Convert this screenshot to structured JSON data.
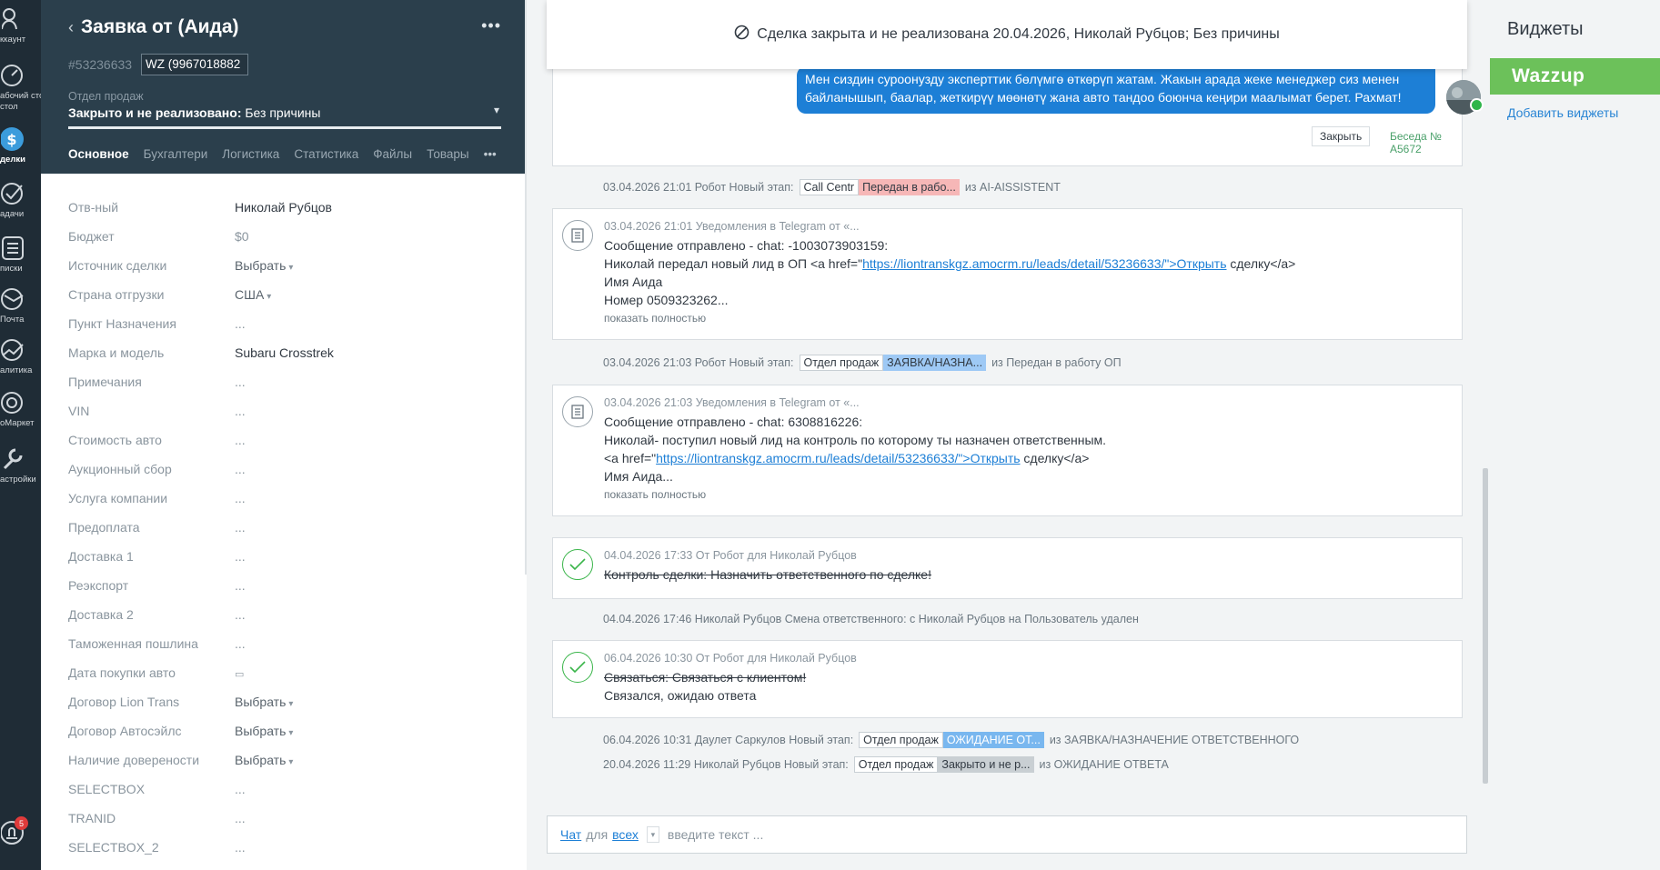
{
  "nav": {
    "items": [
      {
        "label": "ккаунт",
        "icon": "account-icon"
      },
      {
        "label": "абочий стол",
        "label2": "стол",
        "icon": "dashboard-icon"
      },
      {
        "label": "делки",
        "icon": "deals-icon",
        "active": true
      },
      {
        "label": "адачи",
        "icon": "tasks-icon"
      },
      {
        "label": "писки",
        "icon": "lists-icon"
      },
      {
        "label": "Почта",
        "icon": "mail-icon"
      },
      {
        "label": "алитика",
        "icon": "analytics-icon"
      },
      {
        "label": "оМаркет",
        "icon": "market-icon"
      },
      {
        "label": "астройки",
        "icon": "settings-icon"
      }
    ],
    "notifications_count": "5"
  },
  "lead": {
    "title": "Заявка от (Аида)",
    "id": "#53236633",
    "tag": "WZ (9967018882",
    "pipeline_label": "Отдел продаж",
    "status_bold": "Закрыто и не реализовано:",
    "status_reason": " Без причины",
    "tabs": [
      "Основное",
      "Бухгалтери",
      "Логистика",
      "Статистика",
      "Файлы",
      "Товары"
    ],
    "fields": [
      {
        "k": "Отв-ный",
        "v": "Николай Рубцов"
      },
      {
        "k": "Бюджет",
        "v": "$0"
      },
      {
        "k": "Источник сделки",
        "v": "Выбрать"
      },
      {
        "k": "Страна отгрузки",
        "v": "США"
      },
      {
        "k": "Пункт Назначения",
        "v": "..."
      },
      {
        "k": "Марка и модель",
        "v": "Subaru Crosstrek"
      },
      {
        "k": "Примечания",
        "v": "..."
      },
      {
        "k": "VIN",
        "v": "..."
      },
      {
        "k": "Стоимость авто",
        "v": "..."
      },
      {
        "k": "Аукционный сбор",
        "v": "..."
      },
      {
        "k": "Услуга компании",
        "v": "..."
      },
      {
        "k": "Предоплата",
        "v": "..."
      },
      {
        "k": "Доставка 1",
        "v": "..."
      },
      {
        "k": "Реэкспорт",
        "v": "..."
      },
      {
        "k": "Доставка 2",
        "v": "..."
      },
      {
        "k": "Таможенная пошлина",
        "v": "..."
      },
      {
        "k": "Дата покупки авто",
        "v": "▭"
      },
      {
        "k": "Договор Lion Trans",
        "v": "Выбрать"
      },
      {
        "k": "Договор Автосэйлс",
        "v": "Выбрать"
      },
      {
        "k": "Наличие доверености",
        "v": "Выбрать"
      },
      {
        "k": "SELECTBOX",
        "v": "..."
      },
      {
        "k": "TRANID",
        "v": "..."
      },
      {
        "k": "SELECTBOX_2",
        "v": "..."
      }
    ]
  },
  "feed": {
    "closed_banner": "Сделка закрыта и не реализована 20.04.2026, Николай Рубцов; Без причины",
    "wa_message": "Мен сиздин суроонузду эксперттик бөлүмгө өткөрүп жатам. Жакын арада жеке менеджер сиз менен байланышып, баалар, жеткирүү мөөнөтү жана авто тандоо боюнча кеңири маалымат берет. Рахмат!",
    "close_button": "Закрыть",
    "conversation": "Беседа № А5672",
    "event1": {
      "text": "03.04.2026 21:01 Робот Новый этап:",
      "stage": "Call Centr",
      "status": "Передан в рабо...",
      "from": "из AI-AISSISTENT"
    },
    "tg1": {
      "meta": "03.04.2026 21:01 Уведомления в Telegram от «...",
      "line1": "Сообщение отправлено - chat: -1003073903159:",
      "line2_pre": "Николай передал новый лид в ОП <a href=\"",
      "line2_link": "https://liontranskgz.amocrm.ru/leads/detail/53236633/\">Открыть",
      "line2_post": " сделку</a>",
      "line3": "Имя Аида",
      "line4": "Номер 0509323262...",
      "more": "показать полностью"
    },
    "event2": {
      "text": "03.04.2026 21:03 Робот Новый этап:",
      "stage": "Отдел продаж",
      "status": "ЗАЯВКА/НАЗНА...",
      "from": "из Передан в работу ОП"
    },
    "tg2": {
      "meta": "03.04.2026 21:03 Уведомления в Telegram от «...",
      "line1": "Сообщение отправлено - chat: 6308816226:",
      "line2": "Николай- поступил новый лид на контроль по которому ты назначен ответственным.",
      "line3_pre": "<a href=\"",
      "line3_link": "https://liontranskgz.amocrm.ru/leads/detail/53236633/\">Открыть",
      "line3_post": " сделку</a>",
      "line4": "Имя Аида...",
      "more": "показать полностью"
    },
    "task1": {
      "meta": "04.04.2026 17:33   От Робот для Николай Рубцов",
      "text": "Контроль сделки: Назначить ответственного по сделке!"
    },
    "event3": {
      "text": "04.04.2026 17:46 Николай Рубцов Смена ответственного: с Николай Рубцов на Пользователь удален"
    },
    "task2": {
      "meta": "06.04.2026 10:30   От Робот для Николай Рубцов",
      "text": "Связаться: Связаться с клиентом!",
      "result": "Связался, ожидаю ответа"
    },
    "event4": {
      "text": "06.04.2026 10:31 Даулет Саркулов Новый этап:",
      "stage": "Отдел продаж",
      "status": "ОЖИДАНИЕ ОТ...",
      "from": "из ЗАЯВКА/НАЗНАЧЕНИЕ ОТВЕТСТВЕННОГО"
    },
    "event5": {
      "text": "20.04.2026 11:29 Николай Рубцов Новый этап:",
      "stage": "Отдел продаж",
      "status": "Закрыто и не р...",
      "from": "из ОЖИДАНИЕ ОТВЕТА"
    },
    "composer": {
      "chat": "Чат",
      "for": "для",
      "all": "всех",
      "placeholder": "введите текст ..."
    }
  },
  "widgets": {
    "title": "Виджеты",
    "wazzup": "Wazzup",
    "add": "Добавить виджеты"
  }
}
